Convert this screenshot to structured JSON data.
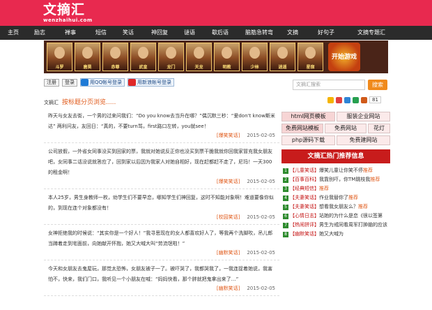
{
  "logo": {
    "cn": "文摘汇",
    "en": "wenzhaihui.com"
  },
  "nav": [
    {
      "label": "主页",
      "w": 38
    },
    {
      "label": "励志",
      "w": 38
    },
    {
      "label": "禅事",
      "w": 50
    },
    {
      "label": "短信",
      "w": 38
    },
    {
      "label": "笑话",
      "w": 40
    },
    {
      "label": "神回复",
      "w": 50
    },
    {
      "label": "谜语",
      "w": 36
    },
    {
      "label": "歇后语",
      "w": 52
    },
    {
      "label": "脑筋急转弯",
      "w": 60
    },
    {
      "label": "文摘",
      "w": 36
    },
    {
      "label": "好句子",
      "w": 60
    },
    {
      "label": "文摘专题汇",
      "w": 70
    }
  ],
  "banner": {
    "heroes": [
      "斗罗",
      "唐昊",
      "赤尊",
      "武皇",
      "龙门",
      "天龙",
      "明教",
      "少林",
      "逍遥",
      "星宿"
    ],
    "badge": "开始游戏"
  },
  "login": {
    "register": "注册",
    "login": "登录",
    "qq": "用QQ帐号登录",
    "weibo": "用新浪帐号登录"
  },
  "search": {
    "placeholder": "文摘汇搜索",
    "button": "搜索"
  },
  "share": {
    "count": "81"
  },
  "crumb": {
    "site": "文摘汇",
    "title": "按标题分页浏览....."
  },
  "items": [
    {
      "text": "昨天与女友去街，一个男的过来问我们：“Do you know去当升在哪？”偶沉默三秒：“爱don't know斯米达” 两利问友，友回日：“真的，不要turn骂，first路口左转，you就see！",
      "tag": "[爆笑笑话]",
      "date": "2015-02-05"
    },
    {
      "text": "公司放假，一外省女同事没买到回家的票，我就对她说反正你也没买到票干脆我就你回我家冒充我女朋友吧，女同事二话没说就答应了，回到家以后因为我家人对她自相好，现在赶都赶不走了，尼玛！一天300的租金啊！",
      "tag": "[爆笑笑话]",
      "date": "2015-02-05"
    },
    {
      "text": "本人25岁，男生身教师一枚，劝学生们不要早恋，哪知学生们神回复，这时不知能对象啊！难道要像你似的，到现在连个对象都没有！",
      "tag": "[校园笑话]",
      "date": "2015-02-05"
    },
    {
      "text": "女神拒绝我的时候说：“其实你是一个好人！”我寻思现在的女人都喜欢好人了，等我再个洗脚吹，吊儿郎当蹲着走到宅面前，向她献开怀抱，她又大喊大叫“劳流氓啦！”",
      "tag": "[幽默笑话]",
      "date": "2015-02-05"
    },
    {
      "text": "今天和女朋友去鬼屋玩，那觉太恐怖，女朋友被子一了。被吓哭了，我都哭我了，一我连捉着她说，我害怕不，快来，我们门口，我听见一个小朋友在喊：“妈妈快看，那个胖就把鬼拿出来了…”",
      "tag": "[幽默笑话]",
      "date": "2015-02-05"
    }
  ],
  "sidebar": {
    "links": [
      "html网页模板",
      "服装企业网站",
      "免费网站模板",
      "免费网站",
      "花灯",
      "php源码下载",
      "免费建网站"
    ],
    "hot_title": "文摘汇热门推荐信息",
    "hot": [
      {
        "cat": "【儿童笑话】",
        "title": "爆笑儿童让你笑不停",
        "rec": "推荐"
      },
      {
        "cat": "【百事百科】",
        "title": "我靠别吓，你TM跳枝我",
        "rec": "推荐"
      },
      {
        "cat": "【经典短信】",
        "title": "",
        "rec": "推荐"
      },
      {
        "cat": "【夫妻笑话】",
        "title": "作业我替你了",
        "rec": "推荐"
      },
      {
        "cat": "【夫妻笑话】",
        "title": "想看我女朋友么？",
        "rec": "推荐"
      },
      {
        "cat": "【心情日志】",
        "title": "站她的为什么是恋《很以签第",
        "rec": ""
      },
      {
        "cat": "【热闹拼评】",
        "title": "男生为戒同看周军打肿脑的应该",
        "rec": ""
      },
      {
        "cat": "【幽默笑话】",
        "title": "她又大喊为",
        "rec": ""
      }
    ]
  }
}
